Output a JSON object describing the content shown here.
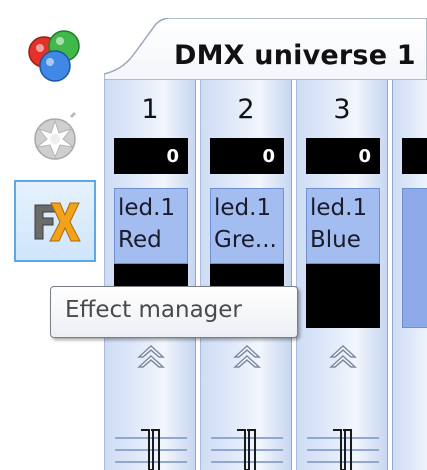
{
  "toolbar": {
    "items": [
      {
        "icon": "colors-icon",
        "active": false
      },
      {
        "icon": "explosion-icon",
        "active": false
      },
      {
        "icon": "fx-icon",
        "active": true
      }
    ]
  },
  "tab": {
    "title": "DMX universe 1"
  },
  "channels": [
    {
      "number": "1",
      "value": "0",
      "label_line1": "led.1",
      "label_line2": "Red"
    },
    {
      "number": "2",
      "value": "0",
      "label_line1": "led.1",
      "label_line2": "Gre..."
    },
    {
      "number": "3",
      "value": "0",
      "label_line1": "led.1",
      "label_line2": "Blue"
    }
  ],
  "tooltip": {
    "text": "Effect manager"
  },
  "colors": {
    "channel_label_bg": "#a4bdf0",
    "active_button_border": "#5ea8e8",
    "fx_icon_orange": "#f2a31c"
  }
}
